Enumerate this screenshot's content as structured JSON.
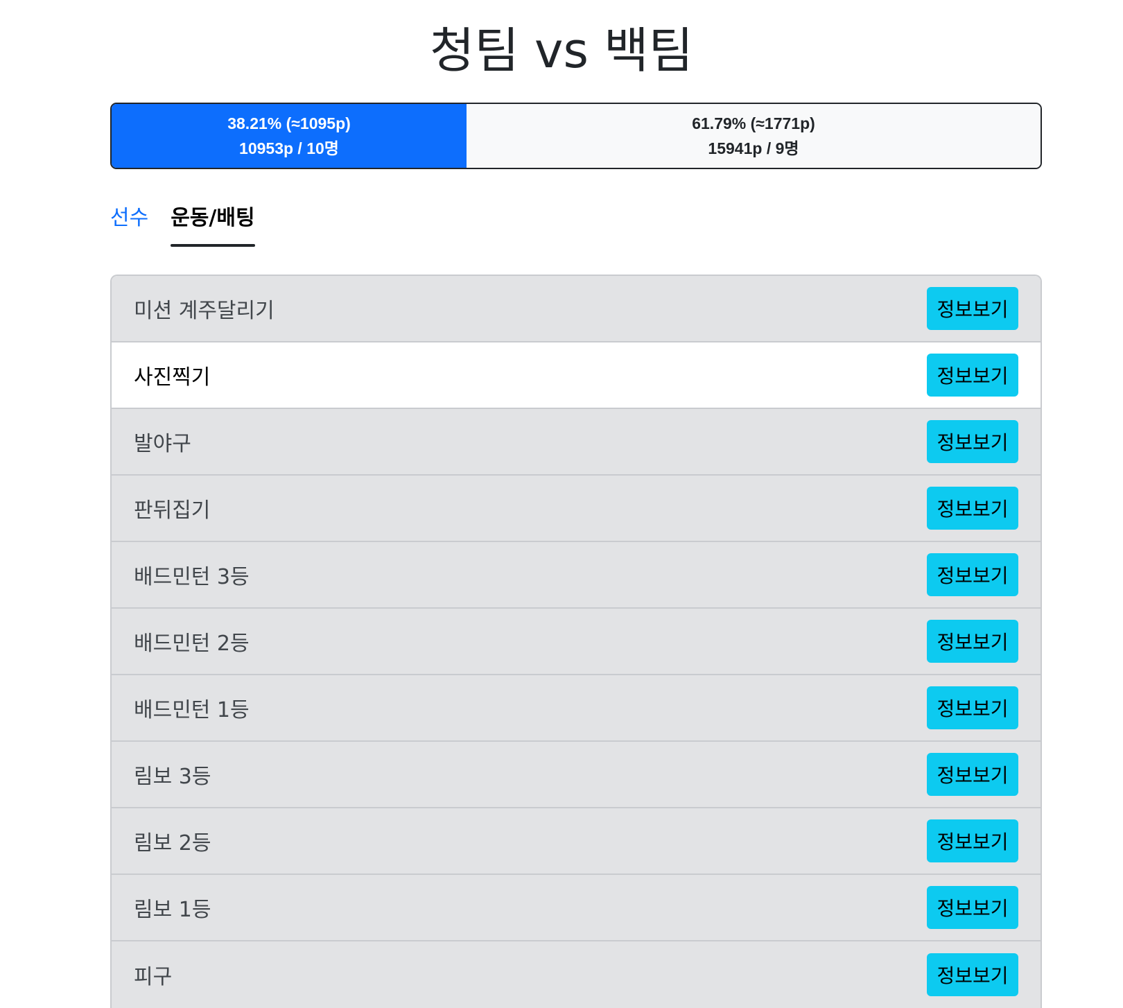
{
  "title": "청팀 vs 백팀",
  "score": {
    "blue": {
      "percent_line": "38.21% (≈1095p)",
      "points_line": "10953p / 10명",
      "share": 0.3821,
      "color": "#0d6efd"
    },
    "white": {
      "percent_line": "61.79% (≈1771p)",
      "points_line": "15941p / 9명",
      "share": 0.6179,
      "color": "#f8f9fa"
    }
  },
  "tabs": [
    {
      "label": "선수",
      "active": false
    },
    {
      "label": "운동/배팅",
      "active": true
    }
  ],
  "events": [
    {
      "name": "미션 계주달리기",
      "button": "정보보기",
      "highlighted": false
    },
    {
      "name": "사진찍기",
      "button": "정보보기",
      "highlighted": true
    },
    {
      "name": "발야구",
      "button": "정보보기",
      "highlighted": false
    },
    {
      "name": "판뒤집기",
      "button": "정보보기",
      "highlighted": false
    },
    {
      "name": "배드민턴 3등",
      "button": "정보보기",
      "highlighted": false
    },
    {
      "name": "배드민턴 2등",
      "button": "정보보기",
      "highlighted": false
    },
    {
      "name": "배드민턴 1등",
      "button": "정보보기",
      "highlighted": false
    },
    {
      "name": "림보 3등",
      "button": "정보보기",
      "highlighted": false
    },
    {
      "name": "림보 2등",
      "button": "정보보기",
      "highlighted": false
    },
    {
      "name": "림보 1등",
      "button": "정보보기",
      "highlighted": false
    },
    {
      "name": "피구",
      "button": "정보보기",
      "highlighted": false
    }
  ]
}
